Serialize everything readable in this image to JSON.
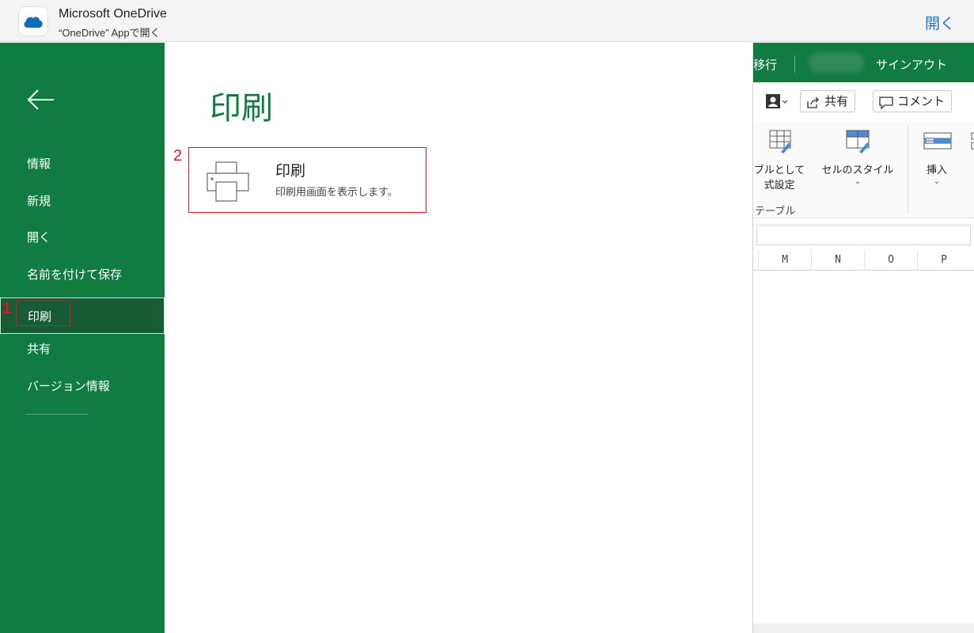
{
  "banner": {
    "title": "Microsoft OneDrive",
    "subtitle": "“OneDrive” Appで開く",
    "open_button": "開く"
  },
  "nav": {
    "items": [
      {
        "label": "情報"
      },
      {
        "label": "新規"
      },
      {
        "label": "開く"
      },
      {
        "label": "名前を付けて保存"
      },
      {
        "label": "印刷",
        "active": true
      },
      {
        "label": "共有"
      },
      {
        "label": "バージョン情報"
      }
    ]
  },
  "content": {
    "heading": "印刷",
    "card": {
      "title": "印刷",
      "description": "印刷用画面を表示します。"
    }
  },
  "annotations": {
    "label1": "1",
    "label2": "2",
    "color": "#e0171e"
  },
  "excel": {
    "topbar": {
      "left_text": "移行",
      "signout": "サインアウト"
    },
    "share_button": "共有",
    "comment_button": "コメント",
    "ribbon": {
      "table_format_line1": "ブルとして",
      "table_format_line2": "式設定",
      "cell_style": "セルのスタイル",
      "insert": "挿入",
      "group_label": "テーブル"
    },
    "columns": [
      "M",
      "N",
      "O",
      "P"
    ]
  },
  "colors": {
    "excel_green": "#107c41",
    "nav_active": "#185c37",
    "link_blue": "#1877d6"
  }
}
